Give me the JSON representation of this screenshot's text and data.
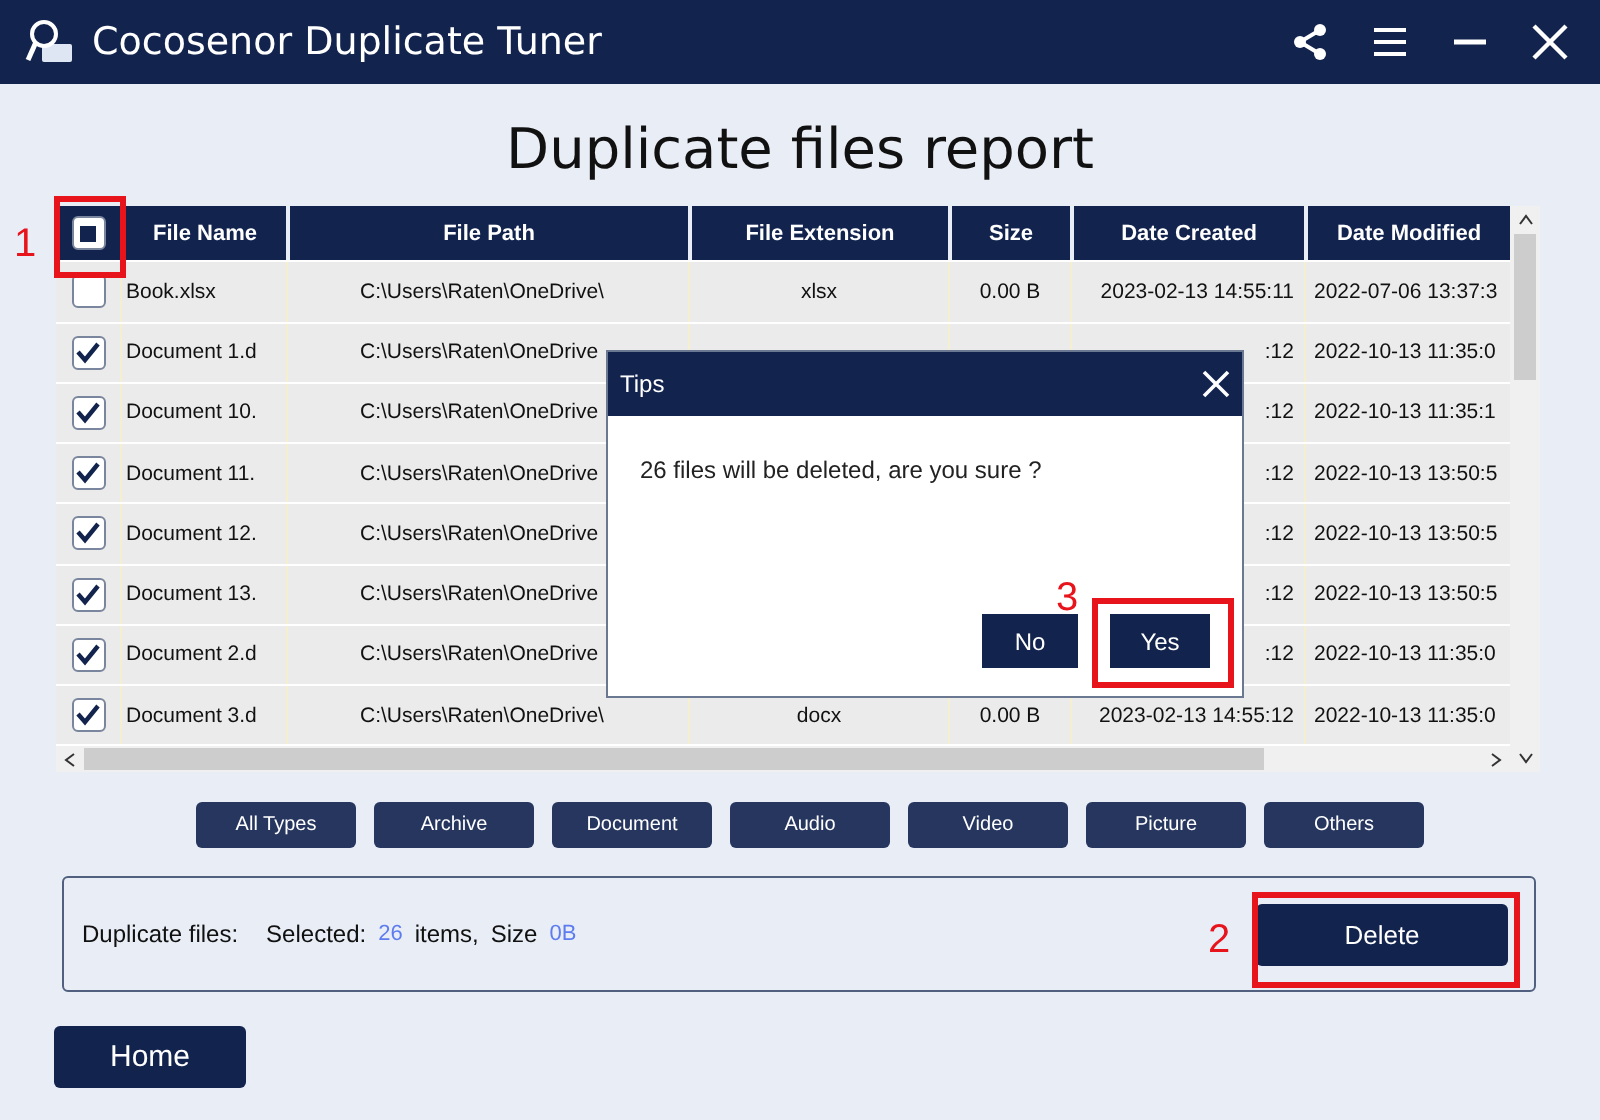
{
  "window": {
    "title": "Cocosenor Duplicate Tuner"
  },
  "heading": "Duplicate files report",
  "table": {
    "header_checkbox": {
      "indeterminate": true
    },
    "columns": [
      "File Name",
      "File Path",
      "File Extension",
      "Size",
      "Date Created",
      "Date Modified"
    ],
    "rows": [
      {
        "checked": false,
        "name": "Book.xlsx",
        "path": "C:\\Users\\Raten\\OneDrive\\",
        "extension": "xlsx",
        "size": "0.00 B",
        "created": "2023-02-13 14:55:11",
        "modified": "2022-07-06 13:37:3"
      },
      {
        "checked": true,
        "name": "Document 1.d",
        "path": "C:\\Users\\Raten\\OneDrive",
        "created": ":12",
        "modified": "2022-10-13 11:35:0"
      },
      {
        "checked": true,
        "name": "Document 10.",
        "path": "C:\\Users\\Raten\\OneDrive",
        "created": ":12",
        "modified": "2022-10-13 11:35:1"
      },
      {
        "checked": true,
        "name": "Document 11.",
        "path": "C:\\Users\\Raten\\OneDrive",
        "created": ":12",
        "modified": "2022-10-13 13:50:5"
      },
      {
        "checked": true,
        "name": "Document 12.",
        "path": "C:\\Users\\Raten\\OneDrive",
        "created": ":12",
        "modified": "2022-10-13 13:50:5"
      },
      {
        "checked": true,
        "name": "Document 13.",
        "path": "C:\\Users\\Raten\\OneDrive",
        "created": ":12",
        "modified": "2022-10-13 13:50:5"
      },
      {
        "checked": true,
        "name": "Document 2.d",
        "path": "C:\\Users\\Raten\\OneDrive",
        "created": ":12",
        "modified": "2022-10-13 11:35:0"
      },
      {
        "checked": true,
        "name": "Document 3.d",
        "path": "C:\\Users\\Raten\\OneDrive\\",
        "extension": "docx",
        "size": "0.00 B",
        "created": "2023-02-13 14:55:12",
        "modified": "2022-10-13 11:35:0"
      }
    ]
  },
  "filters": [
    "All Types",
    "Archive",
    "Document",
    "Audio",
    "Video",
    "Picture",
    "Others"
  ],
  "summary": {
    "label": "Duplicate files:",
    "selected_label": "Selected:",
    "count": "26",
    "items_label": "items,",
    "size_label": "Size",
    "size": "0B"
  },
  "delete_button": "Delete",
  "home_button": "Home",
  "dialog": {
    "title": "Tips",
    "message": "26 files will be deleted, are you sure ?",
    "buttons": [
      "No",
      "Yes"
    ]
  },
  "annotations": [
    {
      "kind": "header-checkbox",
      "label": "1"
    },
    {
      "kind": "delete",
      "label": "2"
    },
    {
      "kind": "yes",
      "label": "3"
    }
  ]
}
